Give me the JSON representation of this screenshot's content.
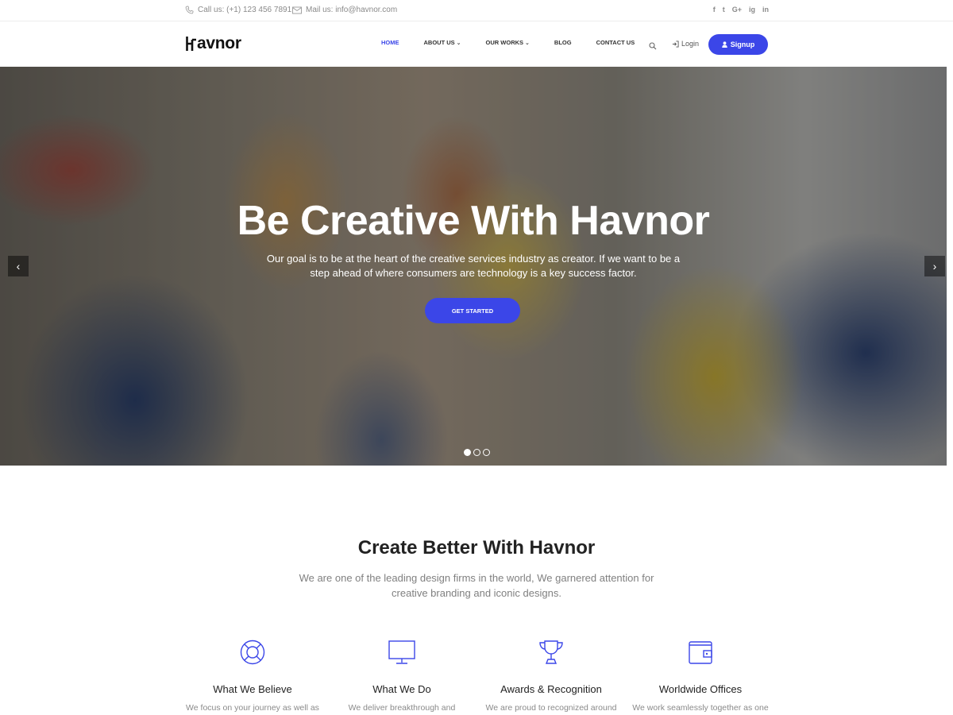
{
  "topbar": {
    "phone": "Call us: (+1) 123 456 7891",
    "email": "Mail us: info@havnor.com",
    "social": [
      "f",
      "t",
      "G+",
      "ig",
      "in"
    ]
  },
  "nav": {
    "logo": "avnor",
    "items": [
      {
        "label": "HOME",
        "caret": ""
      },
      {
        "label": "ABOUT US",
        "caret": "⌄"
      },
      {
        "label": "OUR WORKS",
        "caret": "⌄"
      },
      {
        "label": "BLOG",
        "caret": ""
      },
      {
        "label": "CONTACT US",
        "caret": ""
      }
    ],
    "login": "Login",
    "signup": "Signup"
  },
  "hero": {
    "title": "Be Creative With Havnor",
    "subtitle": "Our goal is to be at the heart of the creative services industry as creator. If we want to be a step ahead of where consumers are technology is a key success factor.",
    "cta": "GET STARTED",
    "slide_count": 3,
    "active_slide": 1
  },
  "section": {
    "title": "Create Better With Havnor",
    "subtitle": "We are one of the leading design firms in the world, We garnered attention for creative branding and iconic designs."
  },
  "features": [
    {
      "icon": "lifebuoy-icon",
      "title": "What We Believe",
      "text": "We focus on your journey as well as"
    },
    {
      "icon": "monitor-icon",
      "title": "What We Do",
      "text": "We deliver breakthrough and"
    },
    {
      "icon": "trophy-icon",
      "title": "Awards & Recognition",
      "text": "We are proud to recognized around"
    },
    {
      "icon": "wallet-icon",
      "title": "Worldwide Offices",
      "text": "We work seamlessly together as one"
    }
  ],
  "colors": {
    "accent": "#3b46e8",
    "text_muted": "#808080"
  }
}
